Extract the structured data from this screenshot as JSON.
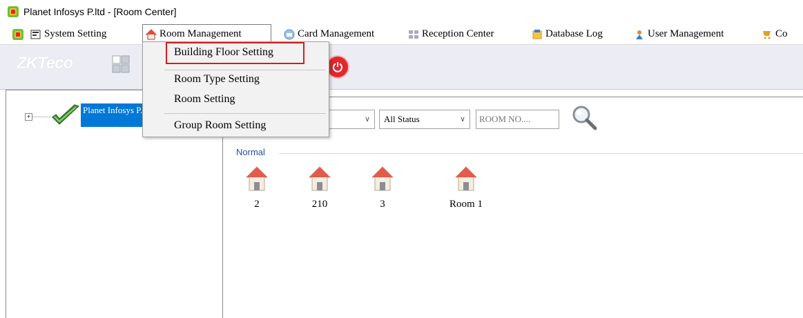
{
  "window": {
    "title": "Planet Infosys P.ltd - [Room Center]"
  },
  "menubar": {
    "items": [
      {
        "label": "System Setting",
        "icon": "system-setting-icon"
      },
      {
        "label": "Room Management",
        "icon": "house-icon"
      },
      {
        "label": "Card Management",
        "icon": "card-icon"
      },
      {
        "label": "Reception Center",
        "icon": "reception-icon"
      },
      {
        "label": "Database Log",
        "icon": "database-icon"
      },
      {
        "label": "User Management",
        "icon": "user-icon"
      },
      {
        "label": "Co",
        "icon": "cart-icon"
      }
    ]
  },
  "toolbar": {
    "logo": "ZKTeco"
  },
  "room_menu": {
    "items": [
      {
        "label": "Building  Floor Setting"
      },
      {
        "label": "Room Type Setting"
      },
      {
        "label": "Room Setting"
      },
      {
        "label": "Group Room Setting"
      }
    ]
  },
  "tree": {
    "root_label": "Planet Infosys P.ltd"
  },
  "filters": {
    "status_value": "All Status",
    "room_no_placeholder": "ROOM NO...."
  },
  "group": {
    "label": "Normal",
    "rooms": [
      "2",
      "210",
      "3",
      "Room 1"
    ]
  },
  "colors": {
    "selection": "#0078d7",
    "highlight_box": "#d61c1c",
    "group_label": "#1f4ea8",
    "power_button": "#e0282e"
  }
}
